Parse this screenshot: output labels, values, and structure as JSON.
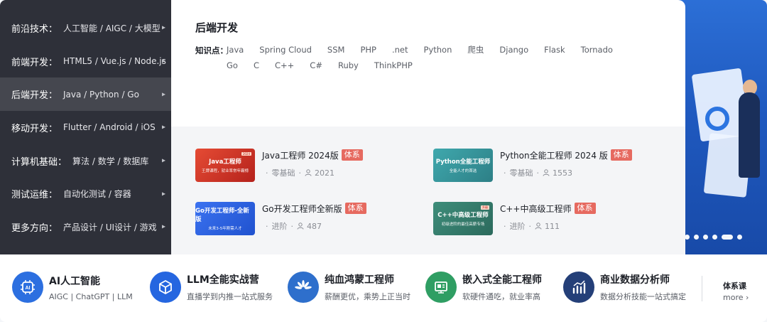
{
  "nav": {
    "items": [
      {
        "category": "前沿技术：",
        "sub": "人工智能 / AIGC / 大模型"
      },
      {
        "category": "前端开发：",
        "sub": "HTML5 / Vue.js / Node.js"
      },
      {
        "category": "后端开发：",
        "sub": "Java / Python / Go"
      },
      {
        "category": "移动开发：",
        "sub": "Flutter / Android / iOS"
      },
      {
        "category": "计算机基础：",
        "sub": "算法 / 数学 / 数据库"
      },
      {
        "category": "测试运维：",
        "sub": "自动化测试 / 容器"
      },
      {
        "category": "更多方向：",
        "sub": "产品设计 / UI设计 / 游戏"
      }
    ],
    "active_index": 2,
    "arrow_icon": "chevron-right-icon"
  },
  "panel": {
    "title": "后端开发",
    "knowledge_label": "知识点：",
    "knowledge_points": [
      "Java",
      "Spring Cloud",
      "SSM",
      "PHP",
      ".net",
      "Python",
      "爬虫",
      "Django",
      "Flask",
      "Tornado",
      "Go",
      "C",
      "C++",
      "C#",
      "Ruby",
      "ThinkPHP"
    ]
  },
  "courses": [
    {
      "name": "Java工程师 2024版",
      "badge": "体系",
      "level": "零基础",
      "learners": "2021",
      "thumb_title": "Java工程师",
      "thumb_sub": "王牌课程，就业率常年霸榜",
      "thumb_tag": "2024"
    },
    {
      "name": "Python全能工程师 2024 版",
      "badge": "体系",
      "level": "零基础",
      "learners": "1553",
      "thumb_title": "Python全能工程师",
      "thumb_sub": "全能人才的首选",
      "thumb_tag": ""
    },
    {
      "name": "Go开发工程师全新版",
      "badge": "体系",
      "level": "进阶",
      "learners": "487",
      "thumb_title": "Go开发工程师-全新版",
      "thumb_sub": "未来3-5年刚需人才",
      "thumb_tag": ""
    },
    {
      "name": "C++中高级工程师",
      "badge": "体系",
      "level": "进阶",
      "learners": "111",
      "thumb_title": "C++中高级工程师",
      "thumb_sub": "初级进阶的最佳高薪专场",
      "thumb_tag": "升级"
    }
  ],
  "features": [
    {
      "title": "AI人工智能",
      "desc": "AIGC | ChatGPT | LLM",
      "icon": "ai-chip-icon",
      "color": "#2c6fe0"
    },
    {
      "title": "LLM全能实战营",
      "desc": "直播学到内推一站式服务",
      "icon": "cube-icon",
      "color": "#2566e0"
    },
    {
      "title": "纯血鸿蒙工程师",
      "desc": "薪酬更优，乘势上正当时",
      "icon": "harmonyos-icon",
      "color": "#2e6fcc"
    },
    {
      "title": "嵌入式全能工程师",
      "desc": "软硬件通吃，就业率高",
      "icon": "circuit-board-icon",
      "color": "#2f9e63"
    },
    {
      "title": "商业数据分析师",
      "desc": "数据分析技能一站式搞定",
      "icon": "bar-chart-icon",
      "color": "#243f78"
    }
  ],
  "more": {
    "label": "体系课",
    "link": "more ›"
  }
}
